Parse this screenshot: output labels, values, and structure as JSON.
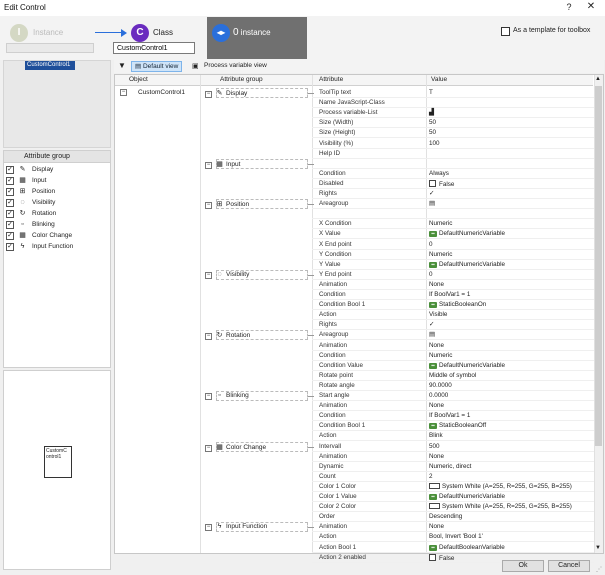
{
  "window": {
    "title": "Edit Control",
    "help": "?",
    "close": "✕"
  },
  "header": {
    "instance_left": {
      "letter": "I",
      "label": "Instance"
    },
    "class": {
      "letter": "C",
      "label": "Class",
      "input_value": "CustomControl1"
    },
    "instance_right": {
      "count": "0",
      "label": "instance"
    },
    "template_label": "As a template for toolbox"
  },
  "tree": {
    "selected": "CustomControl1"
  },
  "attribute_group_panel": {
    "header": "Attribute group",
    "items": [
      {
        "label": "Display",
        "icon": "display-icon",
        "glyph": "✎",
        "checked": true
      },
      {
        "label": "Input",
        "icon": "input-icon",
        "glyph": "▦",
        "checked": true
      },
      {
        "label": "Position",
        "icon": "position-icon",
        "glyph": "⊞",
        "checked": true
      },
      {
        "label": "Visibility",
        "icon": "visibility-icon",
        "glyph": "◌",
        "checked": true
      },
      {
        "label": "Rotation",
        "icon": "rotation-icon",
        "glyph": "↻",
        "checked": true
      },
      {
        "label": "Blinking",
        "icon": "blinking-icon",
        "glyph": "▫",
        "checked": true
      },
      {
        "label": "Color Change",
        "icon": "color-change-icon",
        "glyph": "▦",
        "checked": true
      },
      {
        "label": "Input Function",
        "icon": "input-function-icon",
        "glyph": "ϟ",
        "checked": true
      }
    ]
  },
  "preview": {
    "widget_label": "CustomC ontrol1"
  },
  "toolbar": {
    "default_view": "Default view",
    "process_variable_view": "Process variable view"
  },
  "grid": {
    "headers": {
      "object": "Object",
      "attribute_group": "Attribute group",
      "attribute": "Attribute",
      "value": "Value"
    },
    "object_name": "CustomControl1",
    "groups": [
      {
        "label": "Display",
        "icon": "display-icon",
        "glyph": "✎"
      },
      {
        "label": "Input",
        "icon": "input-icon",
        "glyph": "▦"
      },
      {
        "label": "Position",
        "icon": "position-icon",
        "glyph": "⊞"
      },
      {
        "label": "Visibility",
        "icon": "visibility-icon",
        "glyph": "◌"
      },
      {
        "label": "Rotation",
        "icon": "rotation-icon",
        "glyph": "↻"
      },
      {
        "label": "Blinking",
        "icon": "blinking-icon",
        "glyph": "▫"
      },
      {
        "label": "Color Change",
        "icon": "color-change-icon",
        "glyph": "▦"
      },
      {
        "label": "Input Function",
        "icon": "input-function-icon",
        "glyph": "ϟ"
      }
    ],
    "rows": [
      {
        "attr": "ToolTip text",
        "value": "T",
        "kind": "text"
      },
      {
        "attr": "Name JavaScript-Class",
        "value": "",
        "kind": "text"
      },
      {
        "attr": "Process variable-List",
        "value": "▟",
        "kind": "text"
      },
      {
        "attr": "Size (Width)",
        "value": "50",
        "kind": "text"
      },
      {
        "attr": "Size (Height)",
        "value": "50",
        "kind": "text"
      },
      {
        "attr": "Visibility (%)",
        "value": "100",
        "kind": "text"
      },
      {
        "attr": "Help ID",
        "value": "",
        "kind": "text"
      },
      {
        "attr": "",
        "value": "",
        "kind": "text"
      },
      {
        "attr": "Condition",
        "value": "Always",
        "kind": "text"
      },
      {
        "attr": "Disabled",
        "value": "False",
        "kind": "check"
      },
      {
        "attr": "Rights",
        "value": "✓",
        "kind": "text"
      },
      {
        "attr": "Areagroup",
        "value": "▤",
        "kind": "text"
      },
      {
        "attr": "",
        "value": "",
        "kind": "text"
      },
      {
        "attr": "X Condition",
        "value": "Numeric",
        "kind": "text"
      },
      {
        "attr": "X Value",
        "value": "DefaultNumericVariable",
        "kind": "var"
      },
      {
        "attr": "X End point",
        "value": "0",
        "kind": "text"
      },
      {
        "attr": "Y Condition",
        "value": "Numeric",
        "kind": "text"
      },
      {
        "attr": "Y Value",
        "value": "DefaultNumericVariable",
        "kind": "var"
      },
      {
        "attr": "Y End point",
        "value": "0",
        "kind": "text"
      },
      {
        "attr": "Animation",
        "value": "None",
        "kind": "text"
      },
      {
        "attr": "Condition",
        "value": "If BoolVar1 = 1",
        "kind": "text"
      },
      {
        "attr": "Condition Bool 1",
        "value": "StaticBooleanOn",
        "kind": "var"
      },
      {
        "attr": "Action",
        "value": "Visible",
        "kind": "text"
      },
      {
        "attr": "Rights",
        "value": "✓",
        "kind": "text"
      },
      {
        "attr": "Areagroup",
        "value": "▤",
        "kind": "text"
      },
      {
        "attr": "Animation",
        "value": "None",
        "kind": "text"
      },
      {
        "attr": "Condition",
        "value": "Numeric",
        "kind": "text"
      },
      {
        "attr": "Condition Value",
        "value": "DefaultNumericVariable",
        "kind": "var"
      },
      {
        "attr": "Rotate point",
        "value": "Middle of symbol",
        "kind": "text"
      },
      {
        "attr": "Rotate angle",
        "value": "90.0000",
        "kind": "text"
      },
      {
        "attr": "Start angle",
        "value": "0.0000",
        "kind": "text"
      },
      {
        "attr": "Animation",
        "value": "None",
        "kind": "text"
      },
      {
        "attr": "Condition",
        "value": "If BoolVar1 = 1",
        "kind": "text"
      },
      {
        "attr": "Condition Bool 1",
        "value": "StaticBooleanOff",
        "kind": "var"
      },
      {
        "attr": "Action",
        "value": "Blink",
        "kind": "text"
      },
      {
        "attr": "Intervall",
        "value": "500",
        "kind": "text"
      },
      {
        "attr": "Animation",
        "value": "None",
        "kind": "text"
      },
      {
        "attr": "Dynamic",
        "value": "Numeric, direct",
        "kind": "text"
      },
      {
        "attr": "Count",
        "value": "2",
        "kind": "text"
      },
      {
        "attr": "Color 1 Color",
        "value": "System White (A=255, R=255, G=255, B=255)",
        "kind": "swatch"
      },
      {
        "attr": "Color 1 Value",
        "value": "DefaultNumericVariable",
        "kind": "var"
      },
      {
        "attr": "Color 2 Color",
        "value": "System White (A=255, R=255, G=255, B=255)",
        "kind": "swatch"
      },
      {
        "attr": "Order",
        "value": "Descending",
        "kind": "text"
      },
      {
        "attr": "Animation",
        "value": "None",
        "kind": "text"
      },
      {
        "attr": "Action",
        "value": "Bool, Invert 'Bool 1'",
        "kind": "text"
      },
      {
        "attr": "Action Bool 1",
        "value": "DefaultBooleanVariable",
        "kind": "var"
      },
      {
        "attr": "Action 2 enabled",
        "value": "False",
        "kind": "check"
      }
    ]
  },
  "buttons": {
    "ok": "Ok",
    "cancel": "Cancel"
  },
  "colors": {
    "accent_blue": "#2a6fdb",
    "class_purple": "#6a2bbf",
    "selected_node": "#1f4f9a",
    "instance_panel": "#707070"
  }
}
